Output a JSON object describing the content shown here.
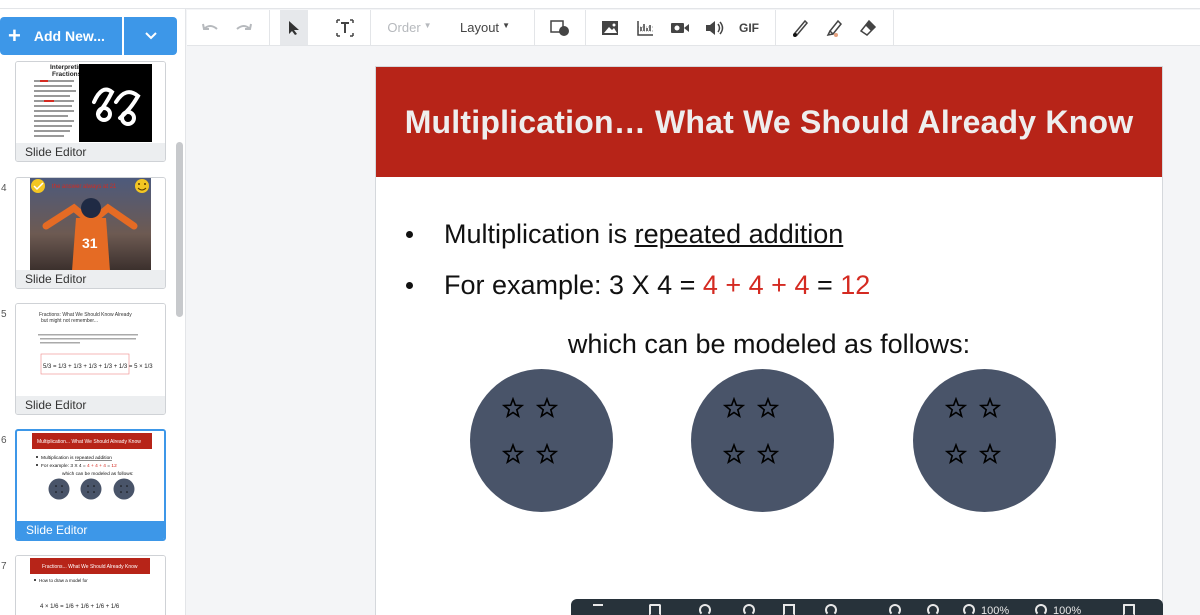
{
  "left_panel": {
    "add_button_label": "Add New...",
    "slides": [
      {
        "num": "",
        "label": "Slide Editor",
        "thumb_title": "Interpreting Fractions"
      },
      {
        "num": "4",
        "label": "Slide Editor",
        "thumb_title": "the answer always at 21"
      },
      {
        "num": "5",
        "label": "Slide Editor",
        "thumb_title": "Fractions: What We Should Know Already but might not remember..."
      },
      {
        "num": "6",
        "label": "Slide Editor",
        "thumb_title": "Multiplication... What We Should Already Know"
      },
      {
        "num": "7",
        "label": "",
        "thumb_title": "Fractions... What We Should Already Know"
      }
    ],
    "thumb5_equation": "5/3 = 1/3 + 1/3 + 1/3 + 1/3 + 1/3 = 5 × 1/3",
    "thumb6_lines": [
      "Multiplication is repeated addition",
      "For example: 3 X 4 = 4 + 4 + 4 = 12",
      "which can be modeled as follows:"
    ],
    "thumb7_line": "How to draw a model for",
    "thumb7_equation": "4 × 1/6 = 1/6 + 1/6 + 1/6 + 1/6",
    "jersey_number": "31"
  },
  "toolbar": {
    "order_label": "Order",
    "layout_label": "Layout",
    "gif_label": "GIF"
  },
  "slide": {
    "title": "Multiplication… What We Should Already Know",
    "bullet1_prefix": "Multiplication is ",
    "bullet1_underlined": "repeated addition",
    "bullet2_prefix": "For example: 3 X 4 = ",
    "bullet2_red_sum": "4 + 4 + 4",
    "bullet2_equals": " = ",
    "bullet2_red_result": "12",
    "subline": "which can be modeled as follows:",
    "circles": [
      {
        "stars": 4
      },
      {
        "stars": 4
      },
      {
        "stars": 4
      }
    ]
  },
  "bottom_bar": {
    "zoom_a": "100%",
    "zoom_b": "100%"
  },
  "colors": {
    "accent": "#3d97e8",
    "header_red": "#b72418",
    "text_red": "#d42a21",
    "circle_fill": "#495469"
  }
}
